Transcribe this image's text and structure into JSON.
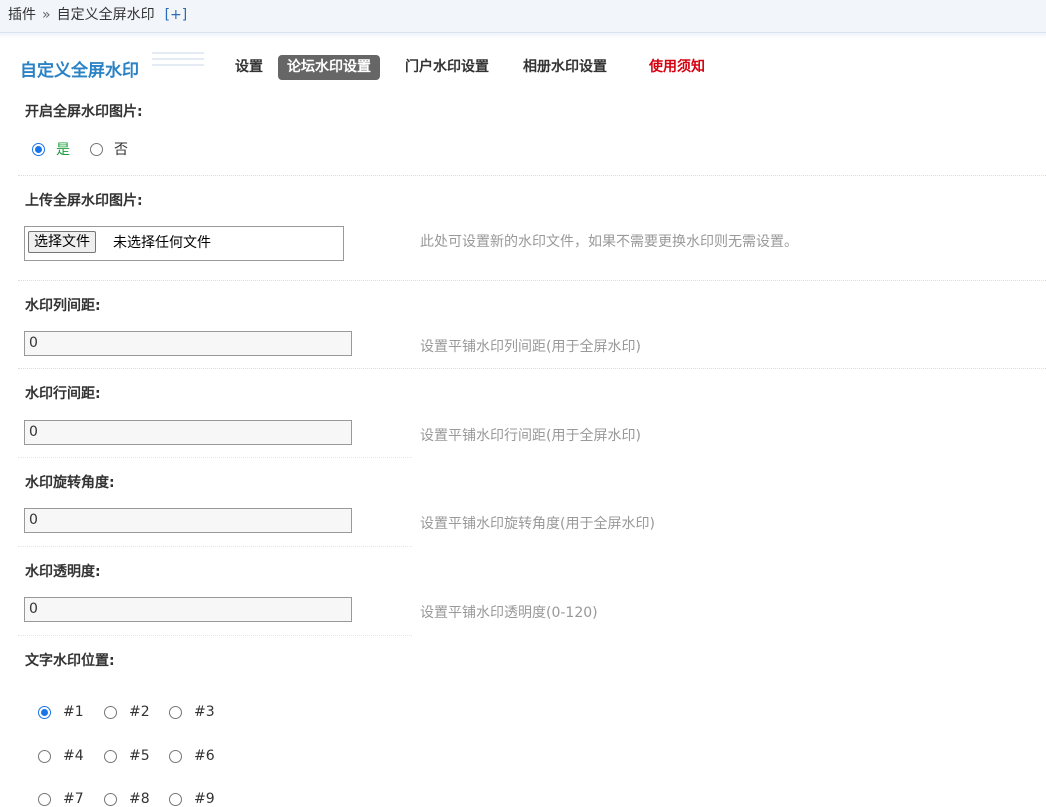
{
  "breadcrumb": {
    "root": "插件",
    "separator": "»",
    "current": "自定义全屏水印",
    "add": "[+]"
  },
  "plugin_title": "自定义全屏水印",
  "tabs": [
    {
      "label": "设置",
      "active": false
    },
    {
      "label": "论坛水印设置",
      "active": true
    },
    {
      "label": "门户水印设置",
      "active": false
    },
    {
      "label": "相册水印设置",
      "active": false
    },
    {
      "label": "使用须知",
      "active": false
    }
  ],
  "enable": {
    "label": "开启全屏水印图片:",
    "options": [
      "是",
      "否"
    ],
    "selected": "是"
  },
  "upload": {
    "label": "上传全屏水印图片:",
    "button": "选择文件",
    "status": "未选择任何文件",
    "hint": "此处可设置新的水印文件，如果不需要更换水印则无需设置。"
  },
  "col_spacing": {
    "label": "水印列间距:",
    "value": "0",
    "hint": "设置平铺水印列间距(用于全屏水印)"
  },
  "row_spacing": {
    "label": "水印行间距:",
    "value": "0",
    "hint": "设置平铺水印行间距(用于全屏水印)"
  },
  "rotation": {
    "label": "水印旋转角度:",
    "value": "0",
    "hint": "设置平铺水印旋转角度(用于全屏水印)"
  },
  "opacity": {
    "label": "水印透明度:",
    "value": "0",
    "hint": "设置平铺水印透明度(0-120)"
  },
  "position": {
    "label": "文字水印位置:",
    "options": [
      "#1",
      "#2",
      "#3",
      "#4",
      "#5",
      "#6",
      "#7",
      "#8",
      "#9"
    ],
    "selected": "#1"
  },
  "colors": {
    "accent": "#2b82c4",
    "notice": "#d7000f",
    "active_tab": "#666666",
    "yes": "#1e9e3a"
  }
}
